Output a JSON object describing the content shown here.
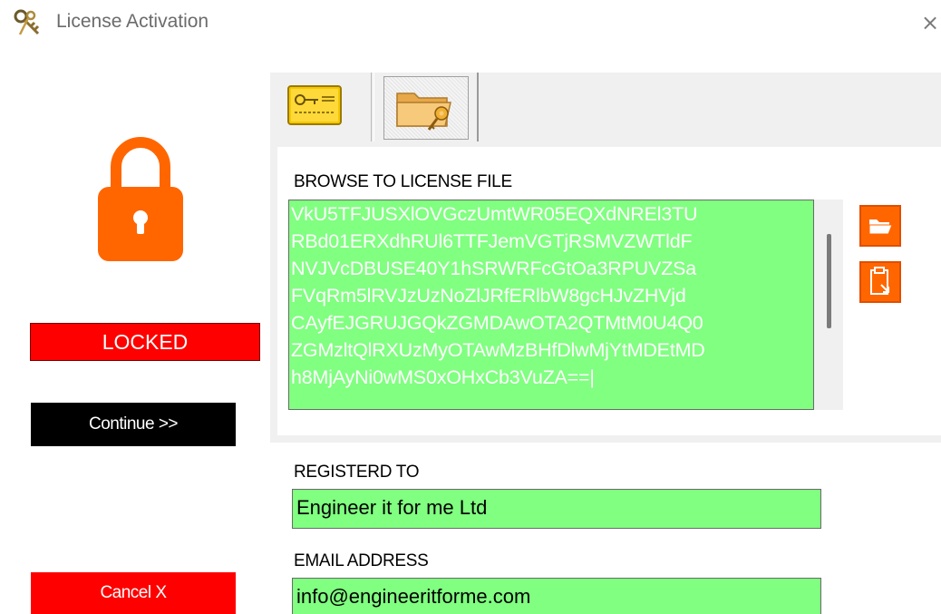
{
  "window": {
    "title": "License Activation",
    "close_glyph": "×",
    "icon": "keys-icon"
  },
  "status": {
    "lock_icon": "padlock-icon",
    "lock_color": "#ff6600",
    "badge_text": "LOCKED",
    "badge_color": "#ff0000"
  },
  "buttons": {
    "continue_label": "Continue >>",
    "cancel_label": "Cancel X"
  },
  "tabs": [
    {
      "icon": "license-key-card-icon",
      "selected": false
    },
    {
      "icon": "folder-key-icon",
      "selected": true
    }
  ],
  "license_file": {
    "label": "BROWSE TO LICENSE FILE",
    "lines": [
      "VkU5TFJUSXlOVGczUmtWR05EQXdNREl3TU",
      "RBd01ERXdhRUl6TTFJemVGTjRSMVZWTldF",
      "NVJVcDBUSE40Y1hSRWRFcGtOa3RPUVZSa",
      "FVqRm5lRVJzUzNoZlJRfERlbW8gcHJvZHVjd",
      "CAyfEJGRUJGQkZGMDAwOTA2QTMtM0U4Q0",
      "ZGMzltQlRXUzMyOTAwMzBHfDlwMjYtMDEtMD",
      "h8MjAyNi0wMS0xOHxCb3VuZA==|"
    ],
    "browse_icon": "open-folder-icon",
    "paste_icon": "paste-clipboard-icon",
    "field_color": "#80ff80"
  },
  "registered": {
    "label": "REGISTERD TO",
    "value": "Engineer it for me Ltd"
  },
  "email": {
    "label": "EMAIL ADDRESS",
    "value": "info@engineeritforme.com"
  }
}
